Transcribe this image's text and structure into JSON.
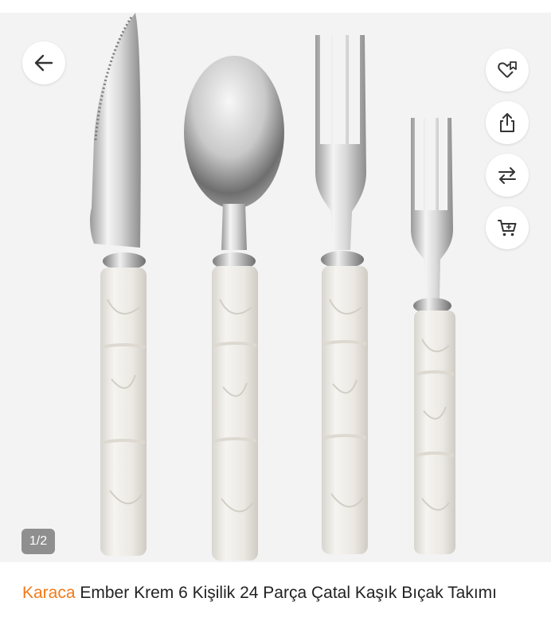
{
  "product": {
    "brand": "Karaca",
    "name": " Ember Krem 6 Kişilik 24 Parça Çatal Kaşık Bıçak Takımı"
  },
  "gallery": {
    "counter": "1/2",
    "image_subject": "cutlery set: knife, spoon, fork, dessert fork with pearl cream handles"
  },
  "actions": {
    "back_icon": "arrow-left-icon",
    "favorite_icon": "heart-collection-icon",
    "share_icon": "share-icon",
    "compare_icon": "compare-arrows-icon",
    "cart_icon": "cart-icon"
  },
  "colors": {
    "brand": "#f27a1a",
    "text": "#222222",
    "background": "#f3f3f3"
  }
}
